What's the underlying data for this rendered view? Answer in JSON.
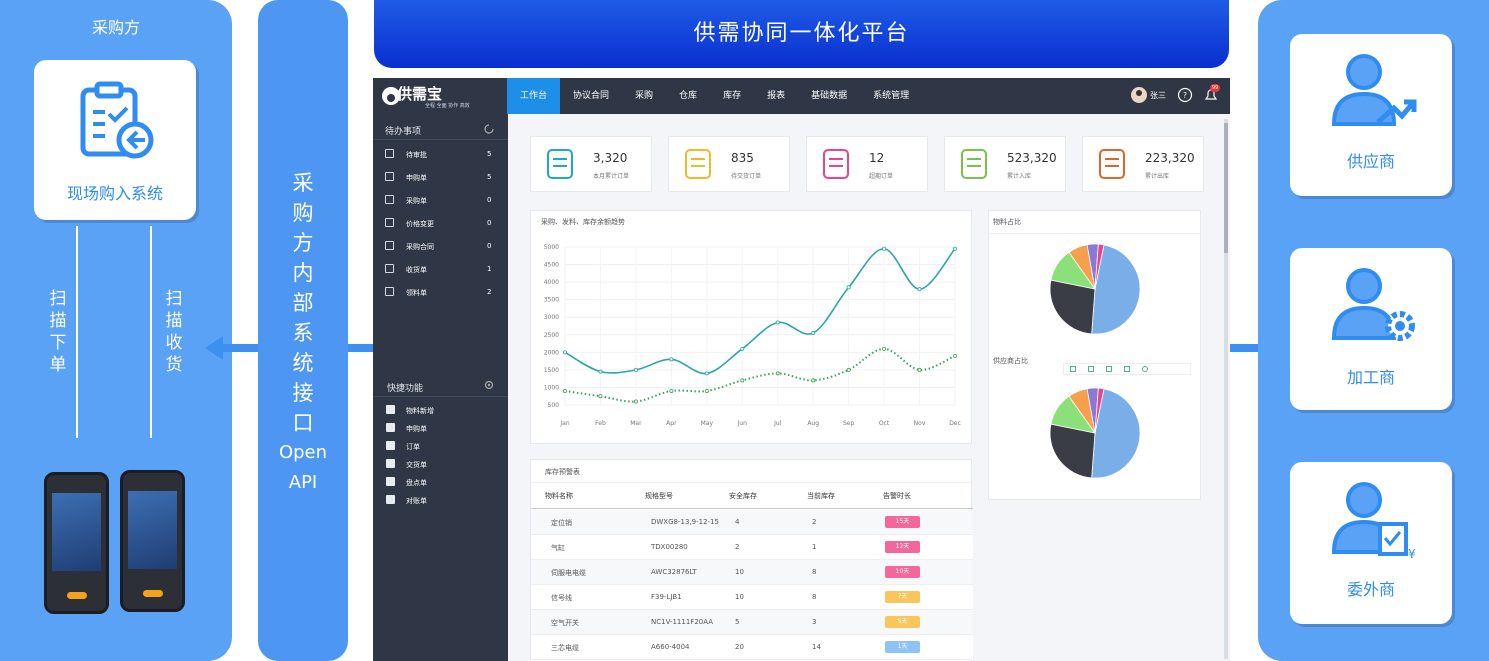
{
  "buyer": {
    "title": "采购方",
    "system_label": "现场购入系统",
    "scan_order": "扫描下单",
    "scan_receive": "扫描收货"
  },
  "api": {
    "chars": [
      "采",
      "购",
      "方",
      "内",
      "部",
      "系",
      "统",
      "接",
      "口"
    ],
    "line1": "Open",
    "line2": "API"
  },
  "banner": {
    "title": "供需协同一体化平台"
  },
  "app": {
    "logo": "供需宝",
    "logo_sub": "全程 全面 协作 高效",
    "nav": [
      "工作台",
      "协议合同",
      "采购",
      "仓库",
      "库存",
      "报表",
      "基础数据",
      "系统管理"
    ],
    "user": "张三",
    "badge": "99",
    "todo_title": "待办事项",
    "todo": [
      {
        "label": "待审批",
        "count": "5"
      },
      {
        "label": "申购单",
        "count": "5"
      },
      {
        "label": "采购单",
        "count": "0"
      },
      {
        "label": "价格变更",
        "count": "0"
      },
      {
        "label": "采购合同",
        "count": "0"
      },
      {
        "label": "收货单",
        "count": "1"
      },
      {
        "label": "领料单",
        "count": "2"
      }
    ],
    "quick_title": "快捷功能",
    "quick": [
      "物料新增",
      "申购单",
      "订单",
      "交货单",
      "盘点单",
      "对账单"
    ],
    "stats": [
      {
        "value": "3,320",
        "label": "本月累计订单",
        "color": "#1fa8c9"
      },
      {
        "value": "835",
        "label": "待交货订单",
        "color": "#f0b92a"
      },
      {
        "value": "12",
        "label": "超期订单",
        "color": "#e8458a"
      },
      {
        "value": "523,320",
        "label": "累计入库",
        "color": "#7cc04b"
      },
      {
        "value": "223,320",
        "label": "累计出库",
        "color": "#d9682b"
      }
    ],
    "line_title": "采购、发料、库存余额趋势",
    "pie1_title": "物料占比",
    "pie2_title": "供应商占比",
    "table_title": "库存预警表",
    "table_headers": [
      "物料名称",
      "规格型号",
      "安全库存",
      "当前库存",
      "告警时长"
    ],
    "table_rows": [
      {
        "name": "定位销",
        "spec": "DWXG8-13,9-12-15",
        "safe": "4",
        "cur": "2",
        "alert": "15天",
        "color": "#f4679b"
      },
      {
        "name": "气缸",
        "spec": "TDX00280",
        "safe": "2",
        "cur": "1",
        "alert": "12天",
        "color": "#f4679b"
      },
      {
        "name": "伺服电电缆",
        "spec": "AWC32876LT",
        "safe": "10",
        "cur": "8",
        "alert": "10天",
        "color": "#f4679b"
      },
      {
        "name": "信号线",
        "spec": "F39-LJB1",
        "safe": "10",
        "cur": "8",
        "alert": "7天",
        "color": "#f9c65c"
      },
      {
        "name": "空气开关",
        "spec": "NC1V-1111F20AA",
        "safe": "5",
        "cur": "3",
        "alert": "5天",
        "color": "#f9c65c"
      },
      {
        "name": "三芯电缆",
        "spec": "A660-4004",
        "safe": "20",
        "cur": "14",
        "alert": "1天",
        "color": "#8fc2f5"
      }
    ]
  },
  "chart_data": [
    {
      "type": "line",
      "title": "采购、发料、库存余额趋势",
      "categories": [
        "Jan",
        "Feb",
        "Mar",
        "Apr",
        "May",
        "Jun",
        "Jul",
        "Aug",
        "Sep",
        "Oct",
        "Nov",
        "Dec"
      ],
      "ylim": [
        500,
        5000
      ],
      "yticks": [
        500,
        1000,
        1500,
        2000,
        2500,
        3000,
        3500,
        4000,
        4500,
        5000
      ],
      "series": [
        {
          "values": [
            2000,
            1450,
            1500,
            1800,
            1400,
            2100,
            2850,
            2550,
            3850,
            4950,
            3800,
            4950
          ],
          "color": "#2aa6a6",
          "style": "solid"
        },
        {
          "values": [
            900,
            750,
            600,
            900,
            900,
            1200,
            1400,
            1200,
            1500,
            2100,
            1500,
            1900
          ],
          "color": "#3aa35a",
          "style": "dotted"
        }
      ]
    },
    {
      "type": "pie",
      "title": "物料占比",
      "values": [
        48,
        27,
        12,
        7,
        4,
        2
      ],
      "colors": [
        "#7aaee8",
        "#3a3d45",
        "#8be07a",
        "#f6a04d",
        "#8a7ad8",
        "#e8458a"
      ]
    },
    {
      "type": "pie",
      "title": "供应商占比",
      "values": [
        48,
        27,
        12,
        7,
        4,
        2
      ],
      "colors": [
        "#7aaee8",
        "#3a3d45",
        "#8be07a",
        "#f6a04d",
        "#8a7ad8",
        "#e8458a"
      ]
    }
  ],
  "partners": {
    "supplier": "供应商",
    "processor": "加工商",
    "outsource": "委外商"
  },
  "colors": {
    "side_blue": "#5aa2f5",
    "api_blue": "#4d97f2",
    "banner_blue": "#0a2fd0",
    "nav_dark": "#2f3645",
    "active": "#1e8fe8"
  }
}
